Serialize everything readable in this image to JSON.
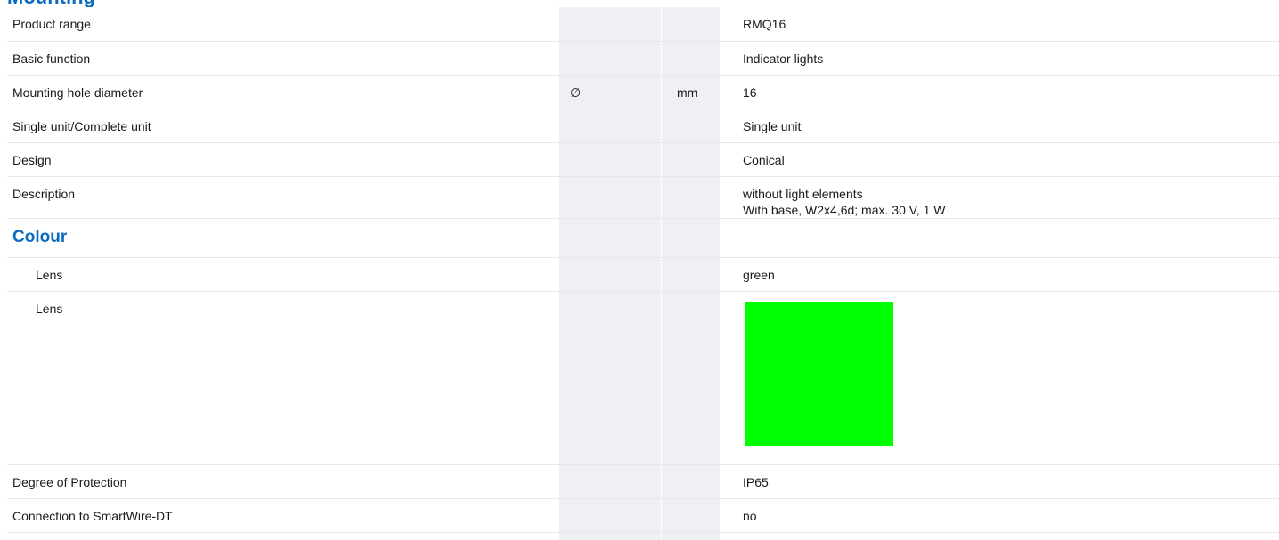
{
  "section_top_heading": "Mounting properties",
  "rows": [
    {
      "label": "Product range",
      "symbol": "",
      "unit": "",
      "value": "RMQ16"
    },
    {
      "label": "Basic function",
      "symbol": "",
      "unit": "",
      "value": "Indicator lights"
    },
    {
      "label": "Mounting hole diameter",
      "symbol": "∅",
      "unit": "mm",
      "value": "16"
    },
    {
      "label": "Single unit/Complete unit",
      "symbol": "",
      "unit": "",
      "value": "Single unit"
    },
    {
      "label": "Design",
      "symbol": "",
      "unit": "",
      "value": "Conical"
    },
    {
      "label": "Description",
      "symbol": "",
      "unit": "",
      "value_line1": "without light elements",
      "value_line2": "With base, W2x4,6d; max. 30 V, 1 W"
    }
  ],
  "colour_section": {
    "heading": "Colour",
    "lens_text_label": "Lens",
    "lens_text_value": "green",
    "lens_swatch_label": "Lens",
    "lens_swatch_color": "#00ff00"
  },
  "rows_after": [
    {
      "label": "Degree of Protection",
      "value": "IP65"
    },
    {
      "label": "Connection to SmartWire-DT",
      "value": "no"
    }
  ],
  "colors": {
    "accent": "#0a6bbf",
    "shade": "#eef0f3",
    "divider": "#e6e8eb"
  }
}
